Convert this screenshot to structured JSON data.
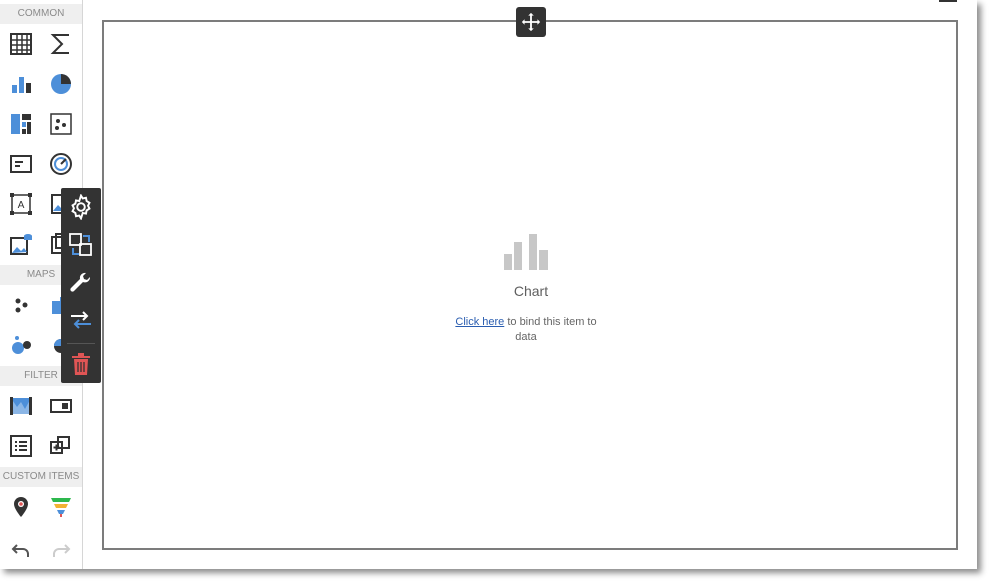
{
  "toolbox": {
    "sections": {
      "common": "COMMON",
      "maps": "MAPS",
      "filter": "FILTER",
      "custom_items": "CUSTOM ITEMS"
    },
    "common_items": [
      "grid-icon",
      "sigma-icon",
      "bar-chart-icon",
      "pie-chart-icon",
      "treemap-icon",
      "scatter-chart-icon",
      "card-icon",
      "gauge-icon",
      "text-box-icon",
      "image-icon",
      "bound-image-icon",
      "group-icon"
    ],
    "map_items": [
      "geo-point-map-icon",
      "choropleth-map-icon",
      "bubble-map-icon",
      "pie-map-icon"
    ],
    "filter_items": [
      "range-filter-icon",
      "combo-box-icon",
      "list-box-icon",
      "tree-view-icon"
    ],
    "custom_items": [
      "online-map-icon",
      "funnel-icon"
    ],
    "history": [
      "undo-icon",
      "redo-icon"
    ]
  },
  "item_menu": {
    "buttons": [
      "gear-icon",
      "convert-icon",
      "wrench-icon",
      "swap-icon",
      "delete-icon"
    ]
  },
  "chart_item": {
    "title": "Chart",
    "link_text": "Click here",
    "bind_text": " to bind this item to data"
  },
  "colors": {
    "accent": "#4d8fd9",
    "delete": "#e05555",
    "dark": "#333333",
    "placeholder": "#c7c7c7"
  }
}
